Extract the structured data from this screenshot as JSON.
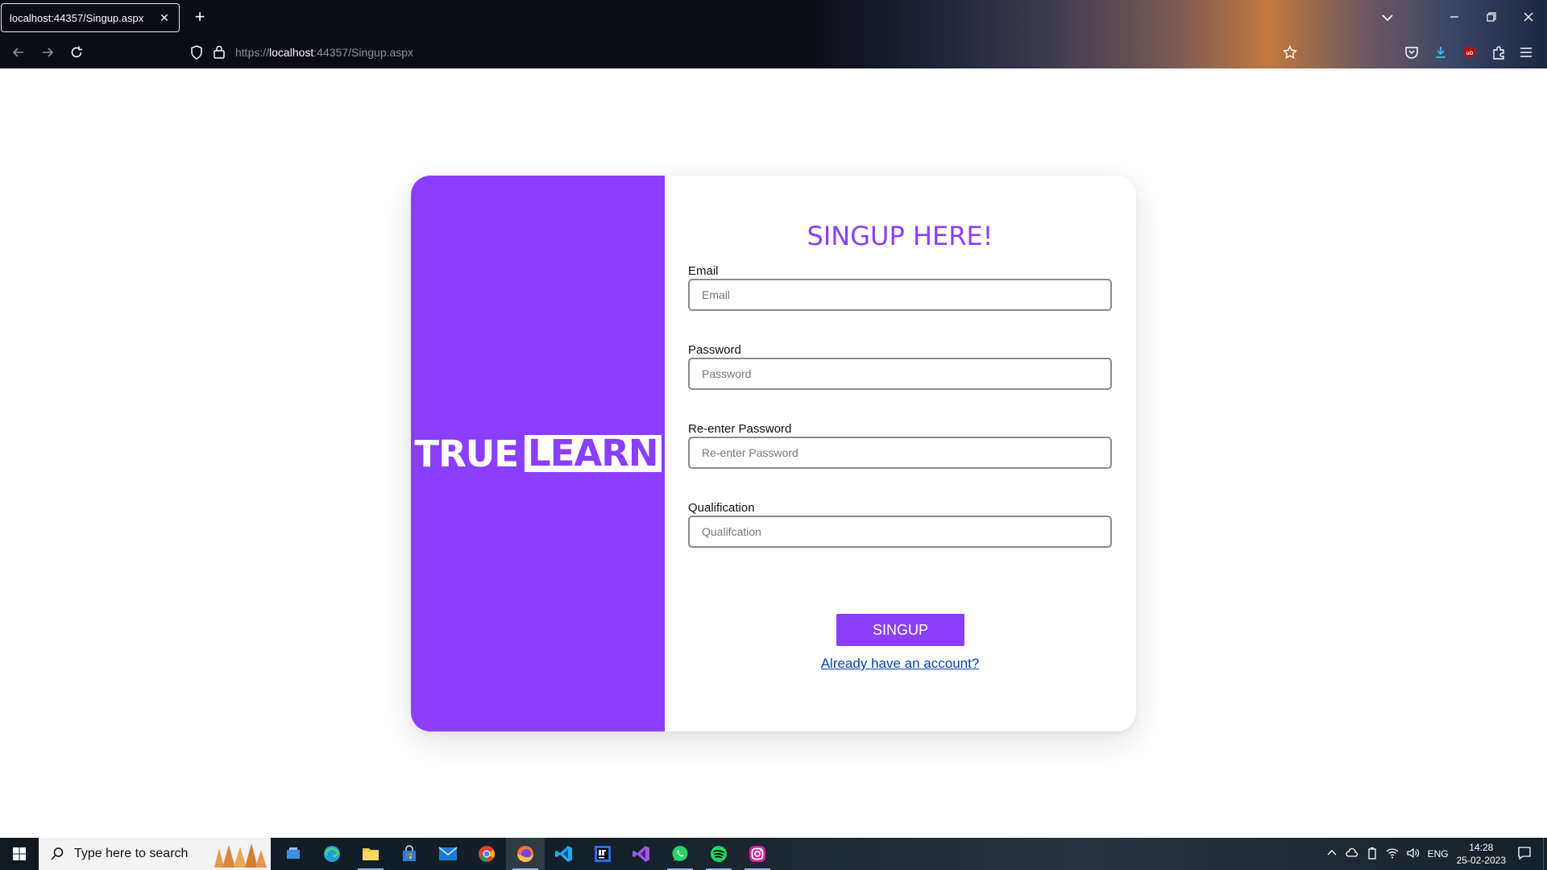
{
  "browser": {
    "tab": {
      "title": "localhost:44357/Singup.aspx",
      "close": "✕"
    },
    "new_tab": "+",
    "url": {
      "prefix": "https://",
      "host": "localhost",
      "path": ":44357/Singup.aspx"
    }
  },
  "brand": {
    "word1": "TRUE",
    "word2": "LEARN",
    "color": "#8a3ffc"
  },
  "form": {
    "title": "SINGUP HERE!",
    "fields": [
      {
        "label": "Email",
        "placeholder": "Email"
      },
      {
        "label": "Password",
        "placeholder": "Password"
      },
      {
        "label": "Re-enter Password",
        "placeholder": "Re-enter Password"
      },
      {
        "label": "Qualification",
        "placeholder": "Qualifcation"
      }
    ],
    "submit_label": "SINGUP",
    "login_link": "Already have an account?"
  },
  "taskbar": {
    "search_placeholder": "Type here to search",
    "apps": [
      "task-view-icon",
      "edge-icon",
      "file-explorer-icon",
      "store-icon",
      "mail-icon",
      "chrome-icon",
      "firefox-icon",
      "vscode-icon",
      "intellij-icon",
      "visual-studio-icon",
      "whatsapp-icon",
      "spotify-icon",
      "instagram-icon"
    ],
    "tray": {
      "language": "ENG",
      "time": "14:28",
      "date": "25-02-2023"
    }
  }
}
